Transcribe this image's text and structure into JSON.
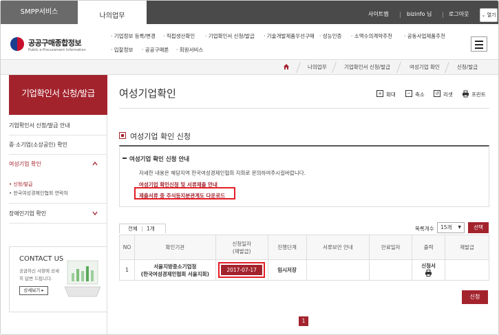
{
  "topbar": {
    "smpp_tab": "SMPP서비스",
    "my_tab": "나의업무",
    "sitemap": "사이트맵",
    "user": "bizinfo 님",
    "logout": "로그아웃",
    "open": "열기"
  },
  "header": {
    "logo_title": "공공구매종합정보",
    "logo_sub": "Public e-Procurement Information",
    "gnb": [
      "기업정보 등록/변경",
      "직접생산확인",
      "기업확인서 신청/발급",
      "기술개발제품우선구매",
      "성능인증",
      "소액수의계약추천",
      "공동사업제품추천",
      "입찰정보",
      "공공구매론",
      "회원서비스"
    ]
  },
  "breadcrumb": [
    "나의업무",
    "기업확인서 신청/발급",
    "여성기업 확인",
    "신청/발급"
  ],
  "sidebar": {
    "title": "기업확인서 신청/발급",
    "items": [
      {
        "label": "기업확인서 신청/발급 안내"
      },
      {
        "label": "중·소기업(소상공인) 확인"
      },
      {
        "label": "여성기업 확인"
      },
      {
        "label": "장애인기업 확인"
      }
    ],
    "subitems": [
      "신청/발급",
      "한국여성경제인협회 연락처"
    ],
    "contact": {
      "title": "CONTACT US",
      "desc": "궁금하신 사항에 상세히 답변 드립니다.",
      "button": "상세보기"
    }
  },
  "main": {
    "title": "여성기업확인",
    "tools": {
      "zoom_in": "확대",
      "zoom_out": "축소",
      "reset": "리셋",
      "print": "프린트"
    },
    "section_title": "여성기업 확인 신청",
    "info": {
      "head": "여성기업 확인 신청 안내",
      "desc": "자세한 내용은 해당지역 한국여성경제인협회 지회로 문의하여주시길바랍니다.",
      "link1": "여성기업 확인신청 및 서류제출 안내",
      "link2": "제출서류 중 주식등지분관계도 다운로드"
    },
    "count": {
      "total_label": "전체",
      "total_value": "1개"
    },
    "perpage": {
      "label": "목록개수",
      "value": "15개"
    },
    "select_button": "선택",
    "table": {
      "headers": [
        "NO",
        "확인기관",
        "신청일자\n(재발급)",
        "진행단계",
        "서류보안 안내",
        "만료일자",
        "출력",
        "재발급"
      ],
      "header_line1": [
        "NO",
        "확인기관",
        "신청일자",
        "진행단계",
        "서류보안 안내",
        "만료일자",
        "출력",
        "재발급"
      ],
      "header_line2_date": "(재발급)",
      "rows": [
        {
          "no": "1",
          "org_line1": "서울지방중소기업청",
          "org_line2": "(한국여성경제인협회 서울지회)",
          "date": "2017-07-17",
          "stage": "임시저장",
          "security": "",
          "expire": "",
          "print_label": "신청서",
          "reissue": ""
        }
      ]
    },
    "apply_button": "신청",
    "pagination": [
      "1"
    ]
  }
}
